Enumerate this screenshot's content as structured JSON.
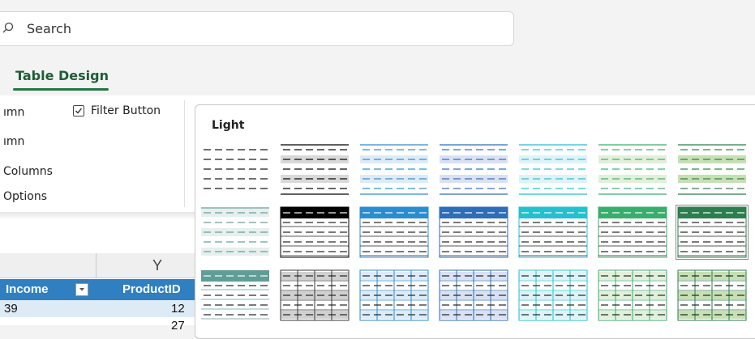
{
  "search": {
    "placeholder": "Search"
  },
  "ribbon": {
    "tab_label": "Table Design",
    "options": {
      "row1": "ımn",
      "filter_button": "Filter Button",
      "row2": "ımn",
      "row3": "Columns",
      "row4": "Options"
    }
  },
  "sheet": {
    "column_letter": "Y",
    "header_income": "Income",
    "header_productid": "ProductID",
    "row1_income": "39",
    "row1_productid": "12",
    "row2_productid": "27"
  },
  "gallery": {
    "section_label": "Light",
    "styles": [
      {
        "name": "None",
        "accent": "#000000",
        "light": "#ffffff",
        "variant": "r1"
      },
      {
        "name": "Light 1",
        "accent": "#000000",
        "light": "#d9d9d9",
        "variant": "r1"
      },
      {
        "name": "Light 2",
        "accent": "#2d8ccc",
        "light": "#ddebf7",
        "variant": "r1"
      },
      {
        "name": "Light 3",
        "accent": "#2f6db5",
        "light": "#d9e1f2",
        "variant": "r1"
      },
      {
        "name": "Light 4",
        "accent": "#25c0cc",
        "light": "#ddf3f7",
        "variant": "r1"
      },
      {
        "name": "Light 5",
        "accent": "#3aad6d",
        "light": "#e2efda",
        "variant": "r1"
      },
      {
        "name": "Light 6",
        "accent": "#2e7d4f",
        "light": "#c6e0b4",
        "variant": "r1"
      },
      {
        "name": "Light 7",
        "accent": "#5f9e97",
        "light": "#e6efee",
        "variant": "r2"
      },
      {
        "name": "Light 8",
        "accent": "#000000",
        "light": "#ffffff",
        "variant": "r2"
      },
      {
        "name": "Light 9",
        "accent": "#2d8ccc",
        "light": "#ffffff",
        "variant": "r2"
      },
      {
        "name": "Light 10",
        "accent": "#2f6db5",
        "light": "#ffffff",
        "variant": "r2"
      },
      {
        "name": "Light 11",
        "accent": "#25c0cc",
        "light": "#ffffff",
        "variant": "r2"
      },
      {
        "name": "Light 12",
        "accent": "#3aad6d",
        "light": "#ffffff",
        "variant": "r2"
      },
      {
        "name": "Light 13",
        "accent": "#2e7d4f",
        "light": "#ffffff",
        "variant": "r2"
      },
      {
        "name": "Light 14",
        "accent": "#5f9e97",
        "light": "#ffffff",
        "variant": "r3"
      },
      {
        "name": "Light 15",
        "accent": "#3a3a3a",
        "light": "#d0d0d0",
        "variant": "r3"
      },
      {
        "name": "Light 16",
        "accent": "#2d8ccc",
        "light": "#ddebf7",
        "variant": "r3"
      },
      {
        "name": "Light 17",
        "accent": "#2f6db5",
        "light": "#d9e1f2",
        "variant": "r3"
      },
      {
        "name": "Light 18",
        "accent": "#25c0cc",
        "light": "#ddf3f7",
        "variant": "r3"
      },
      {
        "name": "Light 19",
        "accent": "#3aad6d",
        "light": "#e2efda",
        "variant": "r3"
      },
      {
        "name": "Light 20",
        "accent": "#2e7d4f",
        "light": "#c6e0b4",
        "variant": "r3"
      }
    ]
  }
}
